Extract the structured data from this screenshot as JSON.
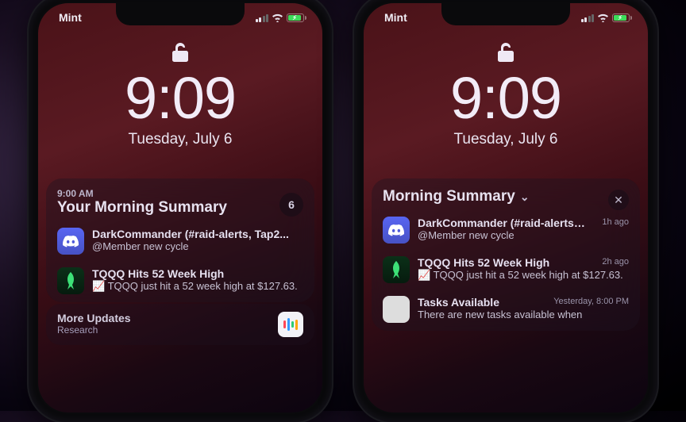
{
  "status": {
    "carrier": "Mint"
  },
  "lock": {
    "time": "9:09",
    "date": "Tuesday, July 6"
  },
  "left_phone": {
    "summary": {
      "overline": "9:00 AM",
      "title": "Your Morning Summary",
      "badge": "6",
      "notifications": [
        {
          "app": "discord",
          "title": "DarkCommander (#raid-alerts, Tap2...",
          "text": "@Member new cycle"
        },
        {
          "app": "robinhood",
          "title": "TQQQ Hits 52 Week High",
          "text": "📈 TQQQ just hit a 52 week high at $127.63."
        }
      ]
    },
    "more": {
      "title": "More Updates",
      "subtitle": "Research"
    }
  },
  "right_phone": {
    "summary": {
      "title": "Morning Summary",
      "notifications": [
        {
          "app": "discord",
          "title": "DarkCommander (#raid-alerts, T...",
          "text": "@Member new cycle",
          "time": "1h ago"
        },
        {
          "app": "robinhood",
          "title": "TQQQ Hits 52 Week High",
          "text": "📈 TQQQ just hit a 52 week high at $127.63.",
          "time": "2h ago"
        },
        {
          "app": "generic",
          "title": "Tasks Available",
          "text": "There are new tasks available when",
          "time": "Yesterday, 8:00 PM"
        }
      ]
    }
  }
}
